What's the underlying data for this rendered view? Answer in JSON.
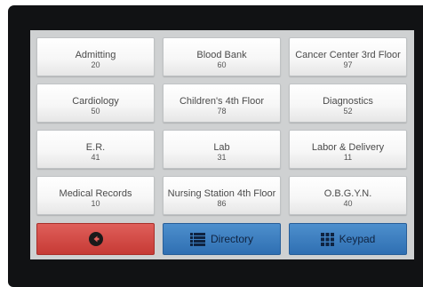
{
  "departments": [
    {
      "name": "Admitting",
      "number": "20"
    },
    {
      "name": "Blood Bank",
      "number": "60"
    },
    {
      "name": "Cancer Center 3rd Floor",
      "number": "97"
    },
    {
      "name": "Cardiology",
      "number": "50"
    },
    {
      "name": "Children's 4th Floor",
      "number": "78"
    },
    {
      "name": "Diagnostics",
      "number": "52"
    },
    {
      "name": "E.R.",
      "number": "41"
    },
    {
      "name": "Lab",
      "number": "31"
    },
    {
      "name": "Labor & Delivery",
      "number": "11"
    },
    {
      "name": "Medical Records",
      "number": "10"
    },
    {
      "name": "Nursing Station 4th Floor",
      "number": "86"
    },
    {
      "name": "O.B.G.Y.N.",
      "number": "40"
    }
  ],
  "buttons": {
    "back_icon": "back-arrow-icon",
    "directory_label": "Directory",
    "directory_icon": "list-icon",
    "keypad_label": "Keypad",
    "keypad_icon": "keypad-grid-icon"
  },
  "colors": {
    "back": "#c63a35",
    "action_blue": "#2f6fb2"
  }
}
